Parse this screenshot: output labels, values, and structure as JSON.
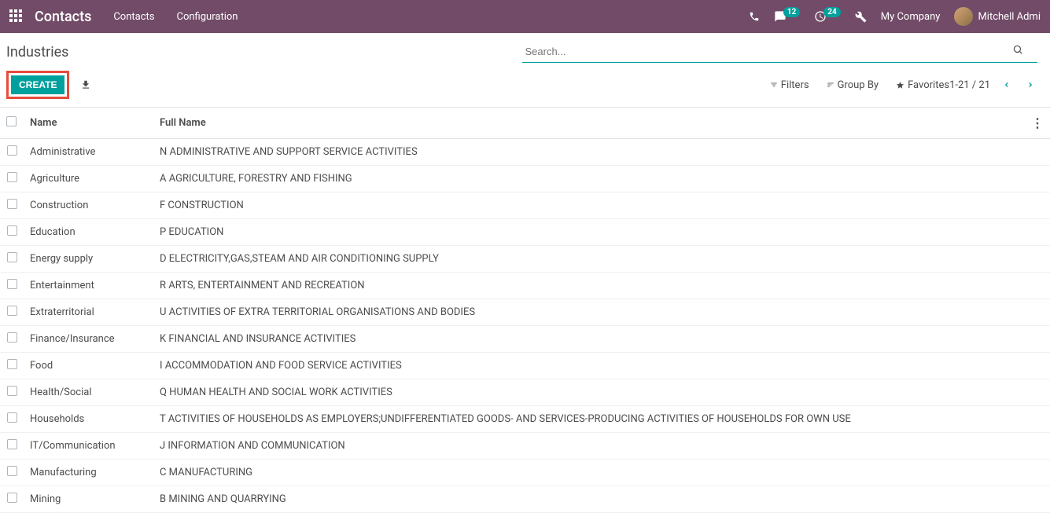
{
  "navbar": {
    "app_title": "Contacts",
    "menu": [
      "Contacts",
      "Configuration"
    ],
    "messages_badge": "12",
    "activities_badge": "24",
    "company": "My Company",
    "user": "Mitchell Admi"
  },
  "control": {
    "breadcrumb": "Industries",
    "search_placeholder": "Search...",
    "create_label": "CREATE",
    "filters_label": "Filters",
    "groupby_label": "Group By",
    "favorites_label": "Favorites",
    "pager": "1-21 / 21"
  },
  "table": {
    "columns": {
      "name": "Name",
      "full_name": "Full Name"
    },
    "rows": [
      {
        "name": "Administrative",
        "full_name": "N ADMINISTRATIVE AND SUPPORT SERVICE ACTIVITIES"
      },
      {
        "name": "Agriculture",
        "full_name": "A AGRICULTURE, FORESTRY AND FISHING"
      },
      {
        "name": "Construction",
        "full_name": "F CONSTRUCTION"
      },
      {
        "name": "Education",
        "full_name": "P EDUCATION"
      },
      {
        "name": "Energy supply",
        "full_name": "D ELECTRICITY,GAS,STEAM AND AIR CONDITIONING SUPPLY"
      },
      {
        "name": "Entertainment",
        "full_name": "R ARTS, ENTERTAINMENT AND RECREATION"
      },
      {
        "name": "Extraterritorial",
        "full_name": "U ACTIVITIES OF EXTRA TERRITORIAL ORGANISATIONS AND BODIES"
      },
      {
        "name": "Finance/Insurance",
        "full_name": "K FINANCIAL AND INSURANCE ACTIVITIES"
      },
      {
        "name": "Food",
        "full_name": "I ACCOMMODATION AND FOOD SERVICE ACTIVITIES"
      },
      {
        "name": "Health/Social",
        "full_name": "Q HUMAN HEALTH AND SOCIAL WORK ACTIVITIES"
      },
      {
        "name": "Households",
        "full_name": "T ACTIVITIES OF HOUSEHOLDS AS EMPLOYERS;UNDIFFERENTIATED GOODS- AND SERVICES-PRODUCING ACTIVITIES OF HOUSEHOLDS FOR OWN USE"
      },
      {
        "name": "IT/Communication",
        "full_name": "J INFORMATION AND COMMUNICATION"
      },
      {
        "name": "Manufacturing",
        "full_name": "C MANUFACTURING"
      },
      {
        "name": "Mining",
        "full_name": "B MINING AND QUARRYING"
      }
    ]
  }
}
